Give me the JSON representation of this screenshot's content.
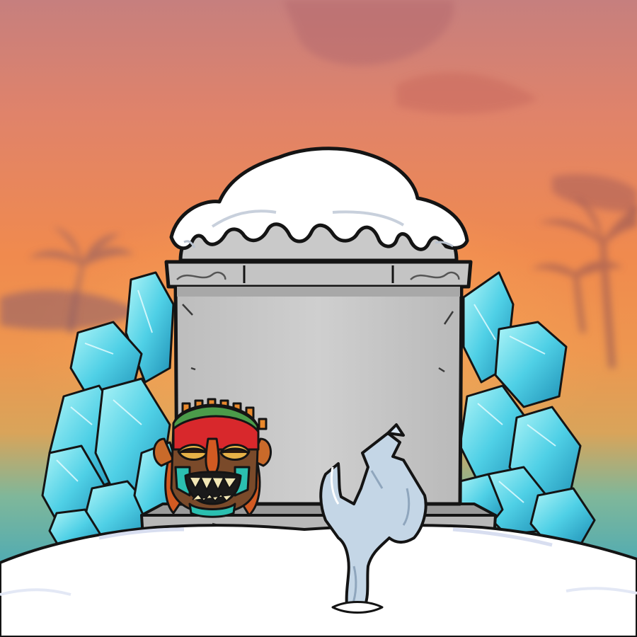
{
  "scene": {
    "type": "illustrated game artwork",
    "elements": [
      "sky",
      "palm-trees",
      "tombstone",
      "snow-cap",
      "ice-crystals",
      "tiki-mask",
      "ice-hand",
      "snow-ground"
    ]
  },
  "colors": {
    "sky_top": "#c87e7a",
    "sky_mid": "#ef8a4e",
    "sky_low": "#e9a64f",
    "sea_teal": "#56b6a9",
    "palm_silhouette": "#9d5c55",
    "stone": "#c9c9c9",
    "stone_dark": "#8f8f8f",
    "snow": "#ffffff",
    "snow_shadow": "#d8def0",
    "ice_light": "#9ff0f4",
    "ice_mid": "#46c8e0",
    "ice_dark": "#1f8fb4",
    "mask_red": "#d8282c",
    "mask_green": "#4b9b4a",
    "mask_teal": "#2bbfb0",
    "mask_wood": "#7a4a2a",
    "ice_hand": "#c4d6e6",
    "outline": "#141414"
  },
  "icons": {
    "tombstone": "tombstone-icon",
    "mask": "tiki-mask-icon",
    "hand": "ice-hand-icon"
  }
}
